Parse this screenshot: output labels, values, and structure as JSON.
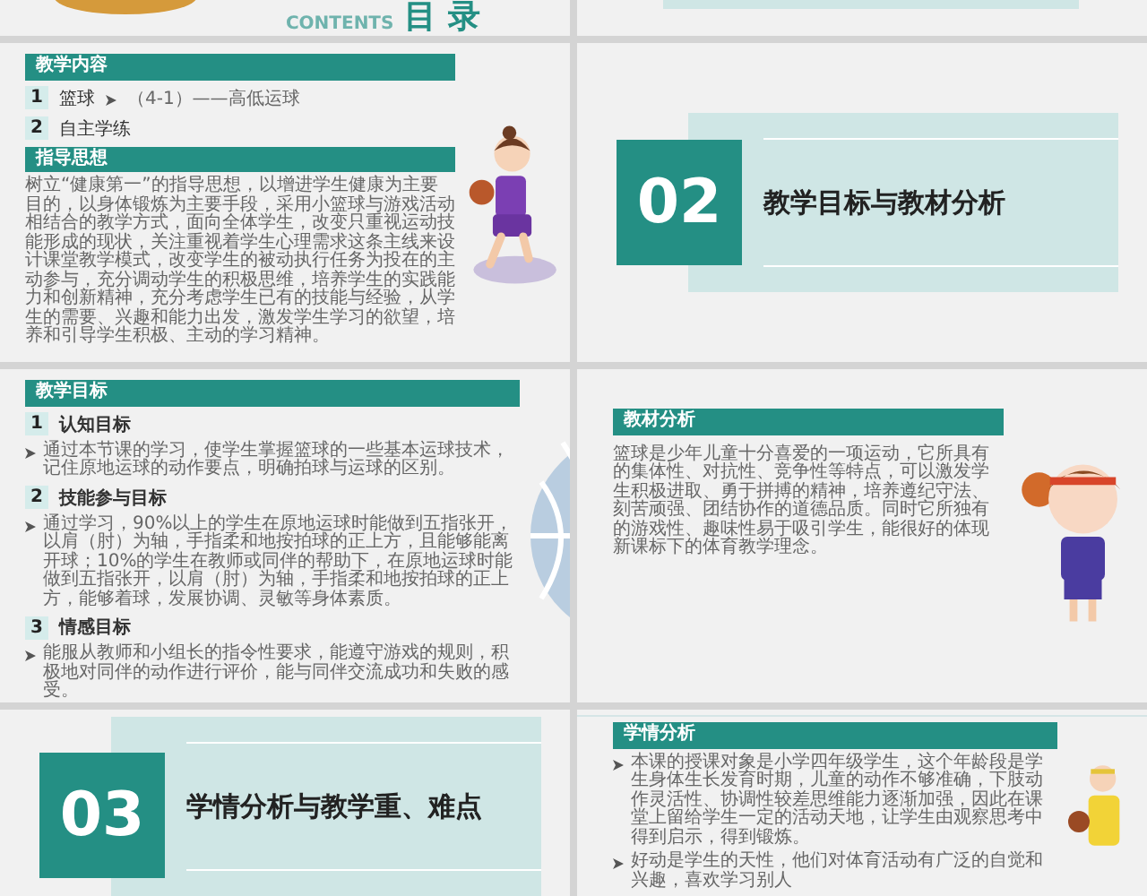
{
  "slides": [
    {
      "kind": "contents",
      "title": "目 录",
      "subtitle": "CONTENTS"
    },
    {
      "kind": "section-tail"
    },
    {
      "kind": "outline",
      "sections": [
        {
          "heading": "教学内容",
          "items": [
            {
              "number": "1",
              "label": "篮球",
              "note": "（4-1）——高低运球"
            },
            {
              "number": "2",
              "label": "自主学练"
            }
          ]
        },
        {
          "heading": "指导思想",
          "paragraph": "树立“健康第一”的指导思想，以增进学生健康为主要目的，以身体锻炼为主要手段，采用小篮球与游戏活动相结合的教学方式，面向全体学生，改变只重视运动技能形成的现状，关注重视着学生心理需求这条主线来设计课堂教学模式，改变学生的被动执行任务为投在的主动参与，充分调动学生的积极思维，培养学生的实践能力和创新精神，充分考虑学生已有的技能与经验，从学生的需要、兴趣和能力出发，激发学生学习的欲望，培养和引导学生积极、主动的学习精神。"
        }
      ]
    },
    {
      "kind": "section",
      "number": "02",
      "title": "教学目标与教材分析"
    },
    {
      "kind": "goals",
      "heading": "教学目标",
      "goals": [
        {
          "number": "1",
          "title": "认知目标",
          "text": "通过本节课的学习，使学生掌握篮球的一些基本运球技术，记住原地运球的动作要点，明确拍球与运球的区别。"
        },
        {
          "number": "2",
          "title": "技能参与目标",
          "text": "通过学习，90%以上的学生在原地运球时能做到五指张开，以肩（肘）为轴，手指柔和地按拍球的正上方，且能够能离开球；10%的学生在教师或同伴的帮助下，在原地运球时能做到五指张开，以肩（肘）为轴，手指柔和地按拍球的正上方，能够着球，发展协调、灵敏等身体素质。"
        },
        {
          "number": "3",
          "title": "情感目标",
          "text": "能服从教师和小组长的指令性要求，能遵守游戏的规则，积极地对同伴的动作进行评价，能与同伴交流成功和失败的感受。"
        }
      ]
    },
    {
      "kind": "analysis",
      "heading": "教材分析",
      "bulleted": false,
      "paragraphs": [
        "篮球是少年儿童十分喜爱的一项运动，它所具有的集体性、对抗性、竞争性等特点，可以激发学生积极进取、勇于拼搏的精神，培养遵纪守法、刻苦顽强、团结协作的道德品质。同时它所独有的游戏性、趣味性易于吸引学生，能很好的体现新课标下的体育教学理念。"
      ]
    },
    {
      "kind": "section",
      "number": "03",
      "title": "学情分析与教学重、难点"
    },
    {
      "kind": "analysis",
      "heading": "学情分析",
      "bulleted": true,
      "paragraphs": [
        "本课的授课对象是小学四年级学生，这个年龄段是学生身体生长发育时期，儿童的动作不够准确，下肢动作灵活性、协调性较差思维能力逐渐加强，因此在课堂上留给学生一定的活动天地，让学生由观察思考中得到启示，得到锻炼。",
        "好动是学生的天性，他们对体育活动有广泛的自觉和兴趣，喜欢学习别人"
      ]
    }
  ]
}
